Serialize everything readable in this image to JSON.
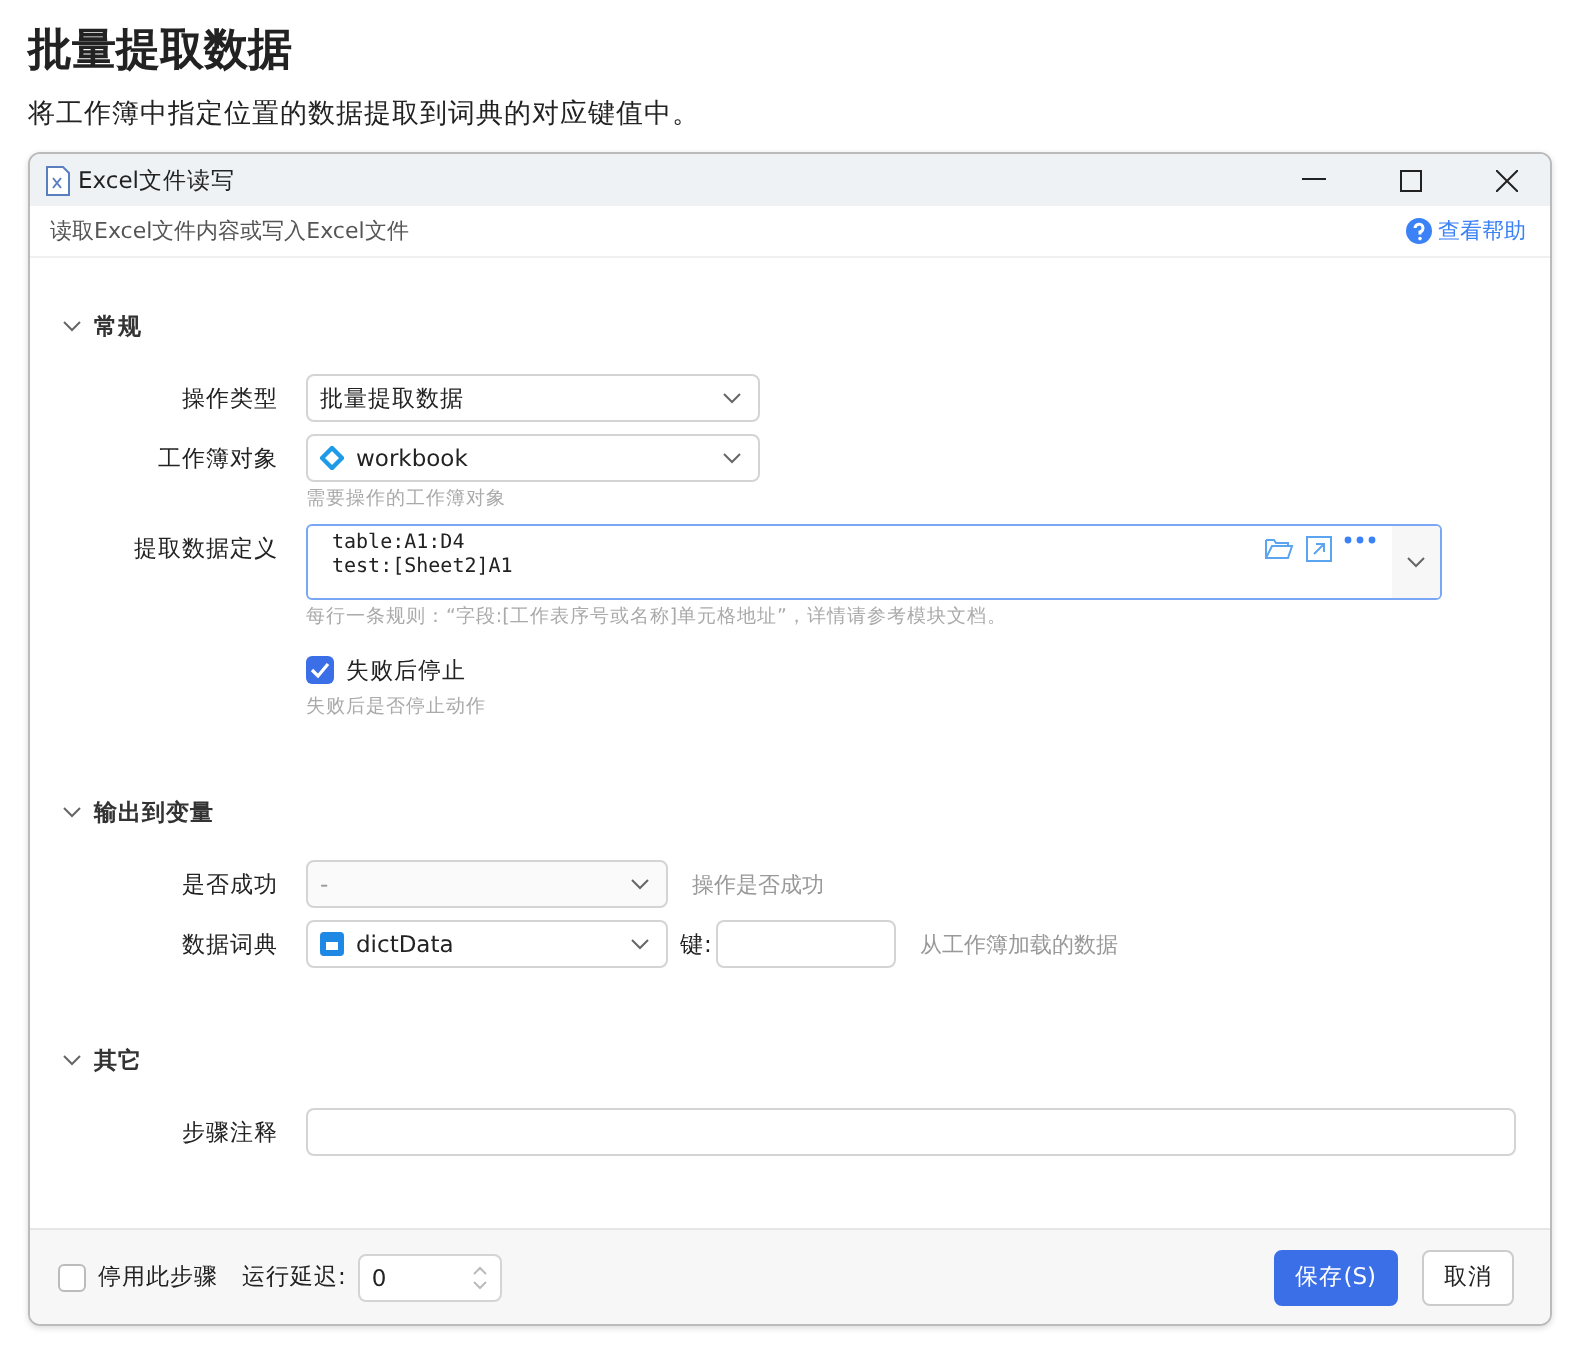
{
  "page": {
    "title": "批量提取数据",
    "description": "将工作簿中指定位置的数据提取到词典的对应键值中。"
  },
  "window": {
    "title": "Excel文件读写",
    "subtitle": "读取Excel文件内容或写入Excel文件",
    "help_link": "查看帮助"
  },
  "sections": [
    {
      "title": "常规",
      "expanded": true,
      "fields": [
        {
          "kind": "select",
          "label": "操作类型",
          "value": "批量提取数据",
          "disabled": false
        },
        {
          "kind": "object_select",
          "label": "工作簿对象",
          "value": "workbook",
          "disabled": false,
          "hint": "需要操作的工作簿对象"
        },
        {
          "kind": "textarea",
          "label": "提取数据定义",
          "lines": [
            "table:A1:D4",
            "test:[Sheet2]A1"
          ],
          "hint": "每行一条规则：“字段:[工作表序号或名称]单元格地址”，详情请参考模块文档。"
        },
        {
          "kind": "checkbox",
          "label": "失败后停止",
          "checked": true,
          "hint": "失败后是否停止动作"
        }
      ]
    },
    {
      "title": "输出到变量",
      "expanded": true,
      "fields": [
        {
          "kind": "select",
          "label": "是否成功",
          "value": "-",
          "disabled": true,
          "aside": "操作是否成功"
        },
        {
          "kind": "dict_select",
          "label": "数据词典",
          "value": "dictData",
          "disabled": false,
          "key_label": "键:",
          "aside": "从工作簿加载的数据"
        }
      ]
    },
    {
      "title": "其它",
      "expanded": true,
      "fields": [
        {
          "kind": "text",
          "label": "步骤注释"
        }
      ]
    }
  ],
  "footer": {
    "disable_step": {
      "label": "停用此步骤",
      "checked": false
    },
    "delay": {
      "label": "运行延迟:",
      "value": "0"
    },
    "buttons": [
      {
        "label": "保存(S)",
        "kind": "primary"
      },
      {
        "label": "取消",
        "kind": "default"
      }
    ]
  }
}
